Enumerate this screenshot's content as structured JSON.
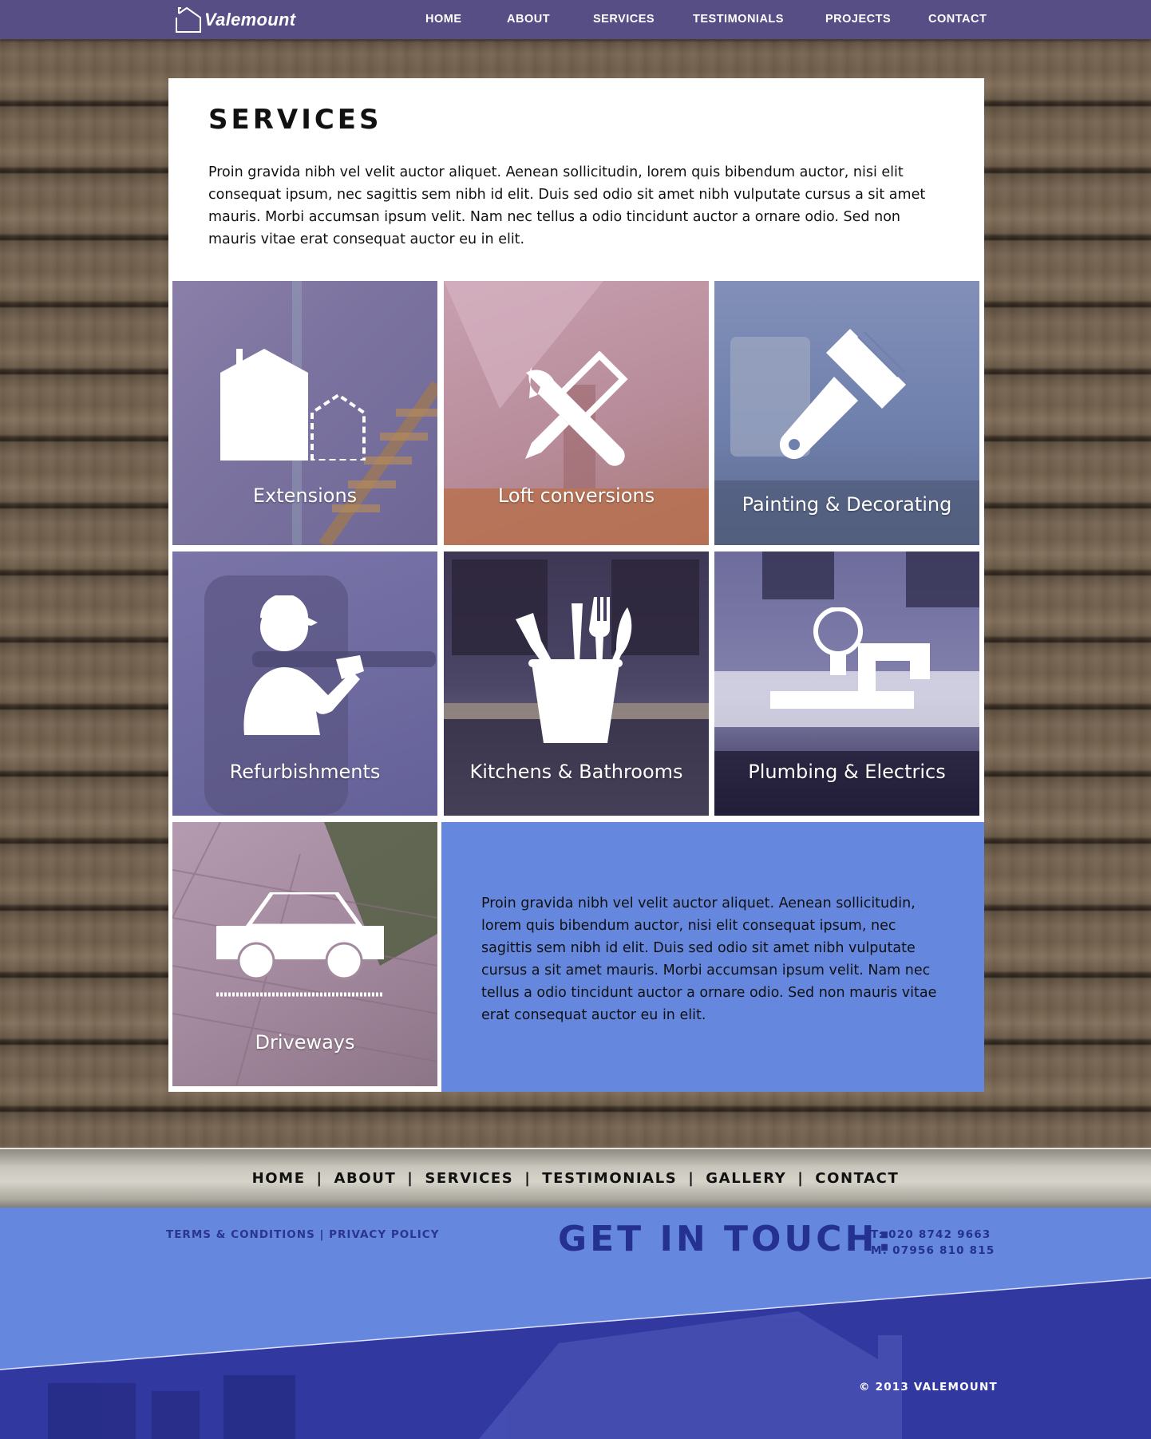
{
  "brand": {
    "name": "Valemount"
  },
  "nav": {
    "items": [
      "HOME",
      "ABOUT",
      "SERVICES",
      "TESTIMONIALS",
      "PROJECTS",
      "CONTACT"
    ]
  },
  "services": {
    "title": "SERVICES",
    "intro": "Proin gravida nibh vel velit auctor aliquet. Aenean sollicitudin, lorem quis bibendum auctor, nisi elit consequat ipsum, nec sagittis sem nibh id elit. Duis sed odio sit amet nibh vulputate cursus a sit amet mauris. Morbi accumsan ipsum velit. Nam nec tellus a odio tincidunt auctor a ornare odio. Sed non mauris vitae erat consequat auctor eu in elit.",
    "tiles": [
      {
        "label": "Extensions",
        "icon": "house-extension-icon"
      },
      {
        "label": "Loft conversions",
        "icon": "tools-icon"
      },
      {
        "label": "Painting & Decorating",
        "icon": "paintbrush-icon"
      },
      {
        "label": "Refurbishments",
        "icon": "builder-icon"
      },
      {
        "label": "Kitchens & Bathrooms",
        "icon": "utensils-cup-icon"
      },
      {
        "label": "Plumbing & Electrics",
        "icon": "bulb-pipe-icon"
      },
      {
        "label": "Driveways",
        "icon": "car-driveway-icon"
      }
    ],
    "info_text": "Proin gravida nibh vel velit auctor aliquet. Aenean sollicitudin, lorem quis bibendum auctor, nisi elit consequat ipsum, nec sagittis sem nibh id elit. Duis sed odio sit amet nibh vulputate cursus a sit amet mauris. Morbi accumsan ipsum velit. Nam nec tellus a odio tincidunt auctor a ornare odio. Sed non  mauris vitae erat consequat auctor eu in elit."
  },
  "footer_nav": {
    "items": [
      "HOME",
      "ABOUT",
      "SERVICES",
      "TESTIMONIALS",
      "GALLERY",
      "CONTACT"
    ],
    "separator": "|"
  },
  "contact": {
    "terms": "TERMS & CONDITIONS",
    "privacy": "PRIVACY POLICY",
    "legal_separator": "|",
    "heading": "GET IN TOUCH:",
    "phone_t": "T: 020 8742 9663",
    "phone_m": "M: 07956 810 815",
    "copyright": "© 2013 VALEMOUNT"
  },
  "colors": {
    "topbar": "#574e86",
    "accent_blue": "#6588de",
    "dark_blue_text": "#253190"
  }
}
